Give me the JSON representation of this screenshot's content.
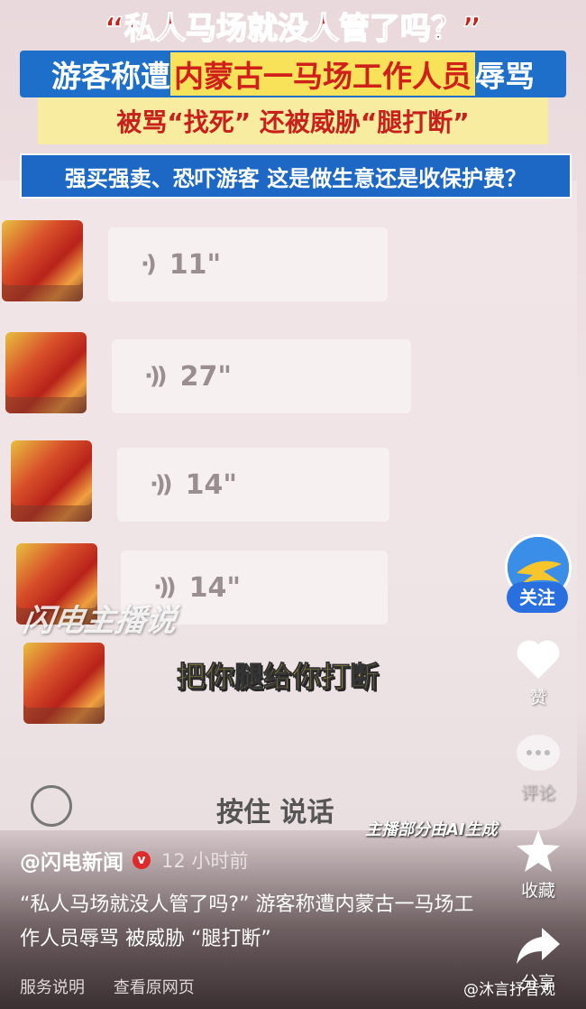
{
  "headline": {
    "title": "“私人马场就没人管了吗？”",
    "line2_pre": "游客称遭",
    "line2_highlight": "内蒙古一马场工作人员",
    "line2_post": "辱骂",
    "line3": "被骂“找死” 还被威胁“腿打断”",
    "line4": "强买强卖、恐吓游客 这是做生意还是收保护费？"
  },
  "chat": {
    "messages": [
      {
        "duration": "11\""
      },
      {
        "duration": "27\""
      },
      {
        "duration": "14\""
      },
      {
        "duration": "14\""
      }
    ],
    "subtitle": "把你腿给你打断",
    "hold_to_talk": "按住 说话",
    "ai_note": "主播部分由AI生成",
    "watermark": "闪电主播说"
  },
  "sidebar": {
    "follow_label": "关注",
    "like_label": "赞",
    "comment_label": "评论",
    "favorite_label": "收藏",
    "share_label": "分享"
  },
  "post": {
    "author": "@闪电新闻",
    "verified": "v",
    "time": "12 小时前",
    "description": "“私人马场就没人管了吗?” 游客称遭内蒙古一马场工作人员辱骂 被威胁 “腿打断”",
    "links": [
      "服务说明",
      "查看原网页"
    ],
    "source_watermark": "@沐言抒昔观"
  }
}
